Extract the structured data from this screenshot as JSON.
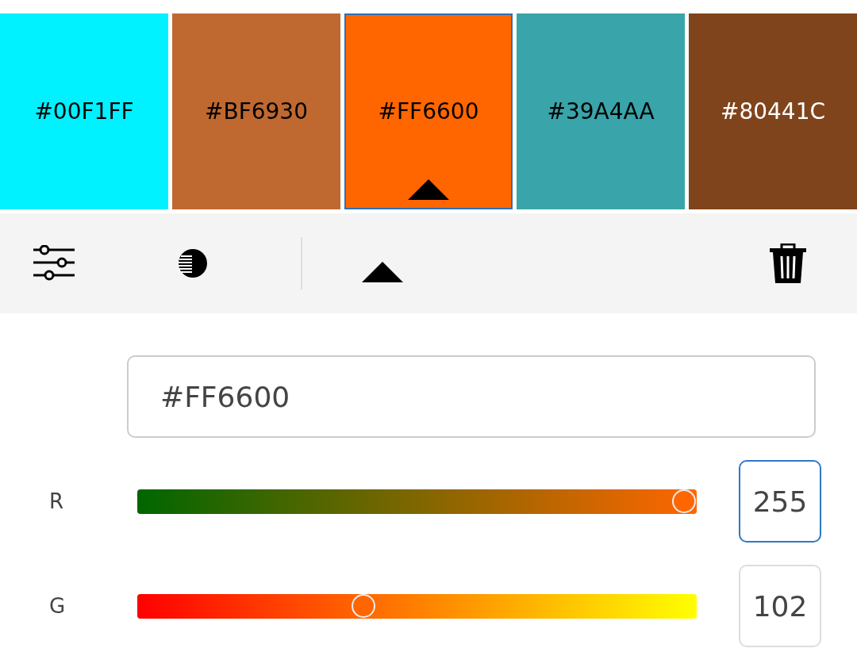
{
  "swatches": [
    {
      "label": "#00F1FF",
      "color": "#00f1ff",
      "selected": false
    },
    {
      "label": "#BF6930",
      "color": "#bf6930",
      "selected": false
    },
    {
      "label": "#FF6600",
      "color": "#ff6600",
      "selected": true
    },
    {
      "label": "#39A4AA",
      "color": "#39a4aa",
      "selected": false
    },
    {
      "label": "#80441C",
      "color": "#80441c",
      "selected": false
    }
  ],
  "hex_field": {
    "value": "#FF6600"
  },
  "channels": [
    {
      "label": "R",
      "level": 1.0,
      "value": "255",
      "focused": true
    },
    {
      "label": "G",
      "level": 0.4,
      "value": "102",
      "focused": false
    }
  ]
}
